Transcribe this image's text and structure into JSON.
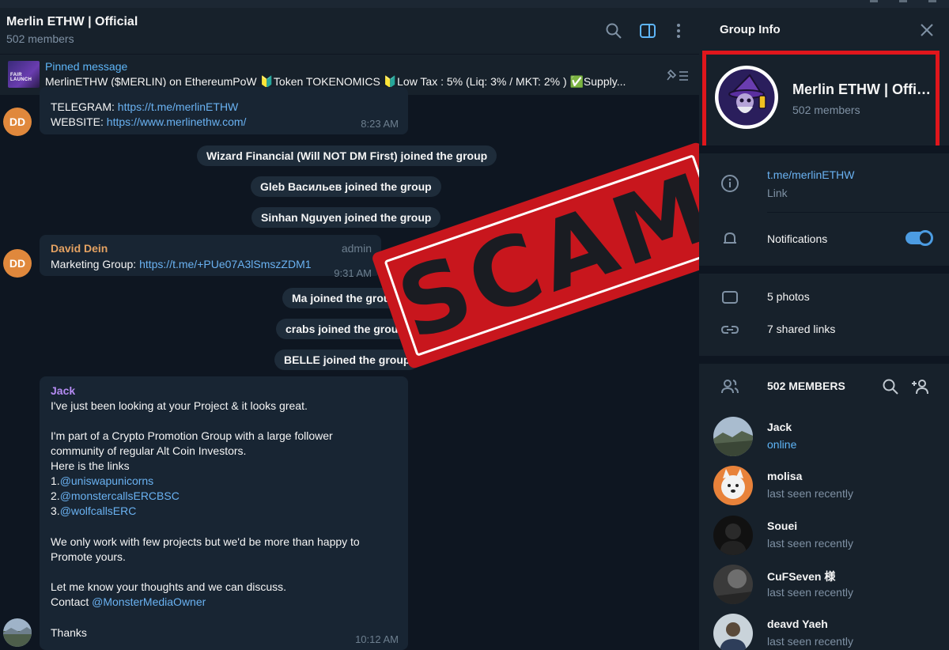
{
  "chat": {
    "title": "Merlin ETHW | Official",
    "subtitle": "502 members",
    "pinned": {
      "label": "Pinned message",
      "thumb_text": "FAIR LAUNCH",
      "text": "MerlinETHW ($MERLIN) on EthereumPoW  🔰Token TOKENOMICS  🔰Low Tax : 5%  (Liq: 3% / MKT: 2% )  ✅Supply..."
    },
    "msg1": {
      "avatar": "DD",
      "line1_label": "TELEGRAM: ",
      "line1_link": "https://t.me/merlinETHW",
      "line2_label": "WEBSITE: ",
      "line2_link": "https://www.merlinethw.com/",
      "time": "8:23 AM"
    },
    "service": [
      "Wizard Financial (Will NOT DM First) joined the group",
      "Gleb Васильев joined the group",
      "Sinhan Nguyen joined the group"
    ],
    "msg2": {
      "avatar": "DD",
      "author": "David Dein",
      "badge": "admin",
      "label": "Marketing Group: ",
      "link": "https://t.me/+PUe07A3lSmszZDM1",
      "time": "9:31 AM"
    },
    "service2": [
      "Ma joined the group",
      "crabs joined the group",
      "BELLE joined the group"
    ],
    "msg3": {
      "author": "Jack",
      "l1": "I've just been looking at your Project & it looks great.",
      "l2": "I'm part of a Crypto Promotion Group with a large follower",
      "l3": "community of regular Alt Coin Investors.",
      "l4": "Here is the links",
      "n1": "1.",
      "link1": "@uniswapunicorns",
      "n2": "2.",
      "link2": "@monstercallsERCBSC",
      "n3": "3.",
      "link3": "@wolfcallsERC",
      "l5": "We only work with few projects but we'd be more than happy to",
      "l6": "Promote yours.",
      "l7": "Let me know your thoughts and we can discuss.",
      "l8_label": "Contact ",
      "link4": "@MonsterMediaOwner",
      "l9": "Thanks",
      "time": "10:12 AM"
    },
    "stamp": "SCAM"
  },
  "panel": {
    "title": "Group Info",
    "group_name": "Merlin ETHW | Official",
    "group_members": "502 members",
    "link": "t.me/merlinETHW",
    "link_label": "Link",
    "notifications": "Notifications",
    "notifications_on": true,
    "photos": "5 photos",
    "shared_links": "7 shared links",
    "members_header": "502 MEMBERS",
    "members": [
      {
        "name": "Jack",
        "status": "online"
      },
      {
        "name": "molisa",
        "status": "last seen recently"
      },
      {
        "name": "Souei",
        "status": "last seen recently"
      },
      {
        "name": "CuFSeven 様",
        "status": "last seen recently"
      },
      {
        "name": "deavd Yaeh",
        "status": "last seen recently"
      }
    ]
  },
  "colors": {
    "background": "#0e1621",
    "panel": "#17212b",
    "bubble": "#182533",
    "link": "#6ab2f2",
    "accent": "#5eb5f7",
    "stamp_red": "#c8161d",
    "highlight_red": "#e0161c"
  }
}
